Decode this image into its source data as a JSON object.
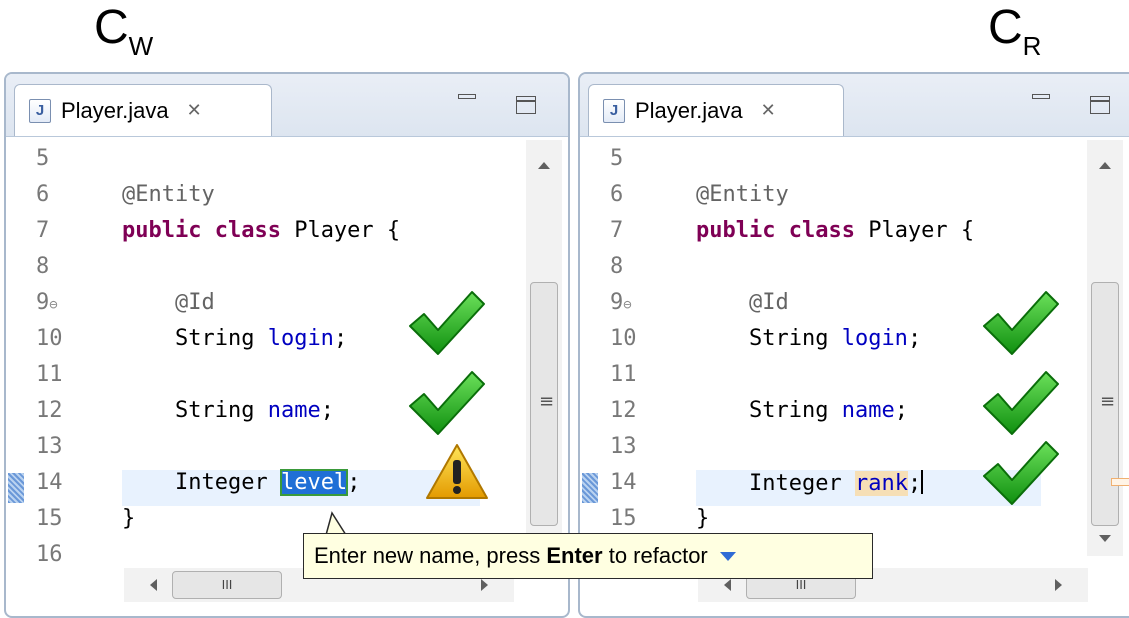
{
  "labels": {
    "left": {
      "main": "C",
      "sub": "W"
    },
    "right": {
      "main": "C",
      "sub": "R"
    }
  },
  "left_editor": {
    "tab_title": "Player.java",
    "tab_close_icon": "close-icon",
    "lines": [
      {
        "num": "5",
        "text": ""
      },
      {
        "num": "6",
        "text": "@Entity"
      },
      {
        "num": "7",
        "kw": "public class",
        "text": " Player {"
      },
      {
        "num": "8",
        "text": ""
      },
      {
        "num": "9",
        "text": "    @Id"
      },
      {
        "num": "10",
        "pre": "    String ",
        "field": "login",
        "post": ";"
      },
      {
        "num": "11",
        "text": ""
      },
      {
        "num": "12",
        "pre": "    String ",
        "field": "name",
        "post": ";"
      },
      {
        "num": "13",
        "text": ""
      },
      {
        "num": "14",
        "pre": "    Integer ",
        "field": "level",
        "post": ";"
      },
      {
        "num": "15",
        "text": "}"
      },
      {
        "num": "16",
        "text": ""
      }
    ],
    "hscroll_grip": "III"
  },
  "right_editor": {
    "tab_title": "Player.java",
    "tab_close_icon": "close-icon",
    "lines": [
      {
        "num": "5",
        "text": ""
      },
      {
        "num": "6",
        "text": "@Entity"
      },
      {
        "num": "7",
        "kw": "public class",
        "text": " Player {"
      },
      {
        "num": "8",
        "text": ""
      },
      {
        "num": "9",
        "text": "    @Id"
      },
      {
        "num": "10",
        "pre": "    String ",
        "field": "login",
        "post": ";"
      },
      {
        "num": "11",
        "text": ""
      },
      {
        "num": "12",
        "pre": "    String ",
        "field": "name",
        "post": ";"
      },
      {
        "num": "13",
        "text": ""
      },
      {
        "num": "14",
        "pre": "    Integer ",
        "field": "rank",
        "post": ";"
      },
      {
        "num": "15",
        "text": "}"
      }
    ],
    "hscroll_grip": "III"
  },
  "tooltip": {
    "prefix": "Enter new name, press ",
    "bold": "Enter",
    "suffix": " to refactor",
    "menu_icon": "dropdown-triangle-icon"
  },
  "colors": {
    "keyword": "#7f0055",
    "field": "#0000c0",
    "check_green": "#22b322",
    "warning_yellow": "#f3c318"
  }
}
